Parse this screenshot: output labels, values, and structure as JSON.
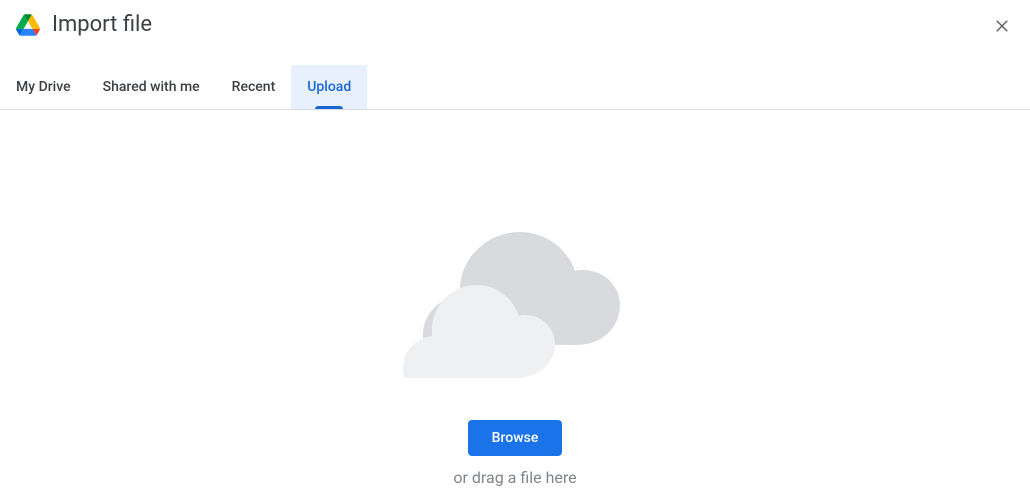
{
  "header": {
    "title": "Import file"
  },
  "tabs": {
    "items": [
      {
        "label": "My Drive"
      },
      {
        "label": "Shared with me"
      },
      {
        "label": "Recent"
      },
      {
        "label": "Upload"
      }
    ]
  },
  "upload": {
    "browse_label": "Browse",
    "drag_text": "or drag a file here"
  }
}
